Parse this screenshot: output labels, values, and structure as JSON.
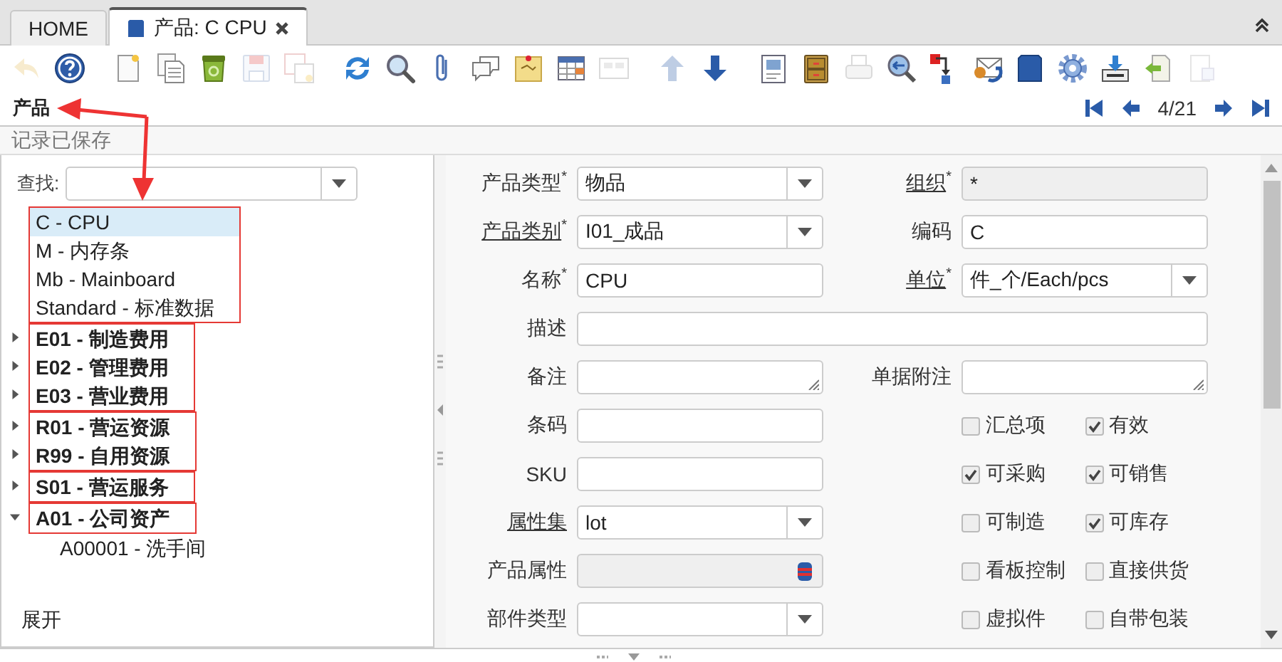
{
  "tabs": [
    {
      "label": "HOME",
      "selected": false,
      "closable": false,
      "icon": false
    },
    {
      "label": "产品: C CPU",
      "selected": true,
      "closable": true,
      "icon": true
    }
  ],
  "toolbar": [
    [
      {
        "kind": "undo",
        "disabled": true
      },
      {
        "kind": "help",
        "disabled": false
      }
    ],
    [
      {
        "kind": "new",
        "disabled": false
      },
      {
        "kind": "copy",
        "disabled": false
      },
      {
        "kind": "delete",
        "disabled": false
      },
      {
        "kind": "save",
        "disabled": true
      },
      {
        "kind": "save-new",
        "disabled": true
      }
    ],
    [
      {
        "kind": "refresh",
        "disabled": false
      },
      {
        "kind": "find",
        "disabled": false
      },
      {
        "kind": "attach",
        "disabled": false
      },
      {
        "kind": "chat",
        "disabled": false
      },
      {
        "kind": "note",
        "disabled": false
      },
      {
        "kind": "grid",
        "disabled": false
      },
      {
        "kind": "multi",
        "disabled": true
      }
    ],
    [
      {
        "kind": "up",
        "disabled": true
      },
      {
        "kind": "down",
        "disabled": false
      }
    ],
    [
      {
        "kind": "report",
        "disabled": false
      },
      {
        "kind": "archive",
        "disabled": false
      },
      {
        "kind": "print",
        "disabled": true
      },
      {
        "kind": "zoom",
        "disabled": false
      },
      {
        "kind": "workflow",
        "disabled": false
      },
      {
        "kind": "mail",
        "disabled": false
      },
      {
        "kind": "cube",
        "disabled": false
      },
      {
        "kind": "gear",
        "disabled": false
      },
      {
        "kind": "download",
        "disabled": false
      },
      {
        "kind": "import",
        "disabled": false
      },
      {
        "kind": "export",
        "disabled": true
      }
    ]
  ],
  "title": "产品",
  "navigation": {
    "position": "4/21"
  },
  "status": "记录已保存",
  "tree": {
    "search_label": "查找:",
    "groups": [
      {
        "outlined": true,
        "items": [
          {
            "label": "C - CPU",
            "kind": "leaf",
            "selected": true
          },
          {
            "label": "M - 内存条",
            "kind": "leaf",
            "selected": false
          },
          {
            "label": "Mb - Mainboard",
            "kind": "leaf",
            "selected": false
          },
          {
            "label": "Standard - 标准数据",
            "kind": "leaf",
            "selected": false
          }
        ]
      },
      {
        "outlined": true,
        "items": [
          {
            "label": "E01 - 制造费用",
            "kind": "branch",
            "expanded": false,
            "selected": false
          },
          {
            "label": "E02 - 管理费用",
            "kind": "branch",
            "expanded": false,
            "selected": false
          },
          {
            "label": "E03 - 营业费用",
            "kind": "branch",
            "expanded": false,
            "selected": false
          }
        ]
      },
      {
        "outlined": true,
        "items": [
          {
            "label": "R01 - 营运资源",
            "kind": "branch",
            "expanded": false,
            "selected": false
          },
          {
            "label": "R99 - 自用资源",
            "kind": "branch",
            "expanded": false,
            "selected": false
          }
        ]
      },
      {
        "outlined": true,
        "items": [
          {
            "label": "S01 - 营运服务",
            "kind": "branch",
            "expanded": false,
            "selected": false
          }
        ]
      },
      {
        "outlined": true,
        "items": [
          {
            "label": "A01 - 公司资产",
            "kind": "branch",
            "expanded": true,
            "selected": false,
            "children": [
              {
                "label": "A00001 - 洗手间",
                "selected": false
              }
            ]
          }
        ]
      }
    ],
    "footer": "展开"
  },
  "annotations": [
    {
      "kind": "arrow"
    },
    {
      "kind": "arrow"
    }
  ],
  "form": {
    "rows": [
      {
        "left": {
          "kind": "combo",
          "label": "产品类型$^{*}$",
          "link": false,
          "value": "物品"
        },
        "right": {
          "kind": "readonly",
          "label": "组织$^{*}$",
          "link": true,
          "value": "*"
        }
      },
      {
        "left": {
          "kind": "combo",
          "label": "产品类别$^{*}$",
          "link": true,
          "value": "I01_成品"
        },
        "right": {
          "kind": "text",
          "label": "编码",
          "link": false,
          "value": "C"
        }
      },
      {
        "left": {
          "kind": "text",
          "label": "名称$^{*}$",
          "link": false,
          "value": "CPU"
        },
        "right": {
          "kind": "combo",
          "label": "单位$^{*}$",
          "link": true,
          "value": "件_个/Each/pcs"
        }
      },
      {
        "wide": {
          "kind": "text",
          "label": "描述",
          "link": false
        }
      },
      {
        "left": {
          "kind": "textarea",
          "label": "备注",
          "link": false
        },
        "right": {
          "kind": "textarea",
          "label": "单据附注",
          "link": false
        }
      },
      {
        "left": {
          "kind": "text",
          "label": "条码",
          "link": false
        },
        "right": {
          "kind": "checks",
          "items": [
            {
              "label": "汇总项",
              "checked": false
            },
            {
              "label": "有效",
              "checked": true
            }
          ]
        }
      },
      {
        "left": {
          "kind": "text",
          "label": "SKU",
          "link": false
        },
        "right": {
          "kind": "checks",
          "items": [
            {
              "label": "可采购",
              "checked": true
            },
            {
              "label": "可销售",
              "checked": true
            }
          ]
        }
      },
      {
        "left": {
          "kind": "combo",
          "label": "属性集",
          "link": true,
          "value": "lot"
        },
        "right": {
          "kind": "checks",
          "items": [
            {
              "label": "可制造",
              "checked": false
            },
            {
              "label": "可库存",
              "checked": true
            }
          ]
        }
      },
      {
        "left": {
          "kind": "attribute",
          "label": "产品属性",
          "link": false
        },
        "right": {
          "kind": "checks",
          "items": [
            {
              "label": "看板控制",
              "checked": false
            },
            {
              "label": "直接供货",
              "checked": false
            }
          ]
        }
      },
      {
        "left": {
          "kind": "combo",
          "label": "部件类型",
          "link": false
        },
        "right": {
          "kind": "checks",
          "items": [
            {
              "label": "虚拟件",
              "checked": false
            },
            {
              "label": "自带包装",
              "checked": false
            }
          ]
        }
      }
    ]
  }
}
